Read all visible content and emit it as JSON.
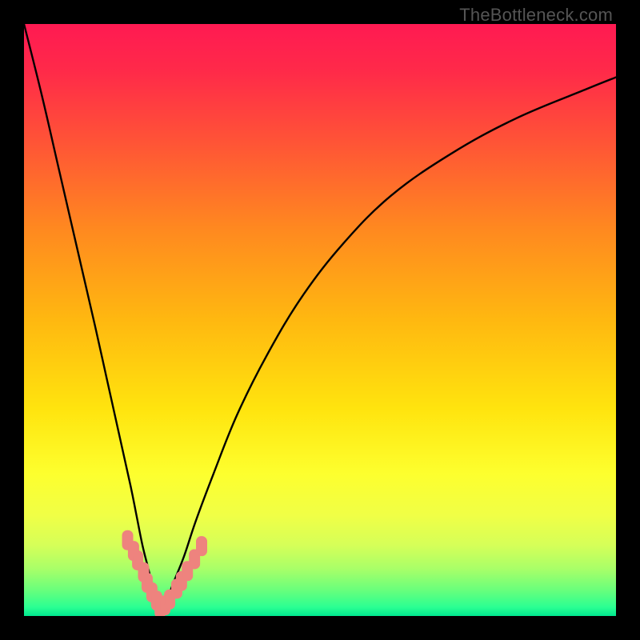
{
  "watermark": "TheBottleneck.com",
  "colors": {
    "frame": "#000000",
    "curve": "#000000",
    "markers_fill": "#ee837e",
    "markers_stroke": "#ee837e",
    "gradient_stops": [
      {
        "offset": 0.0,
        "color": "#ff1a52"
      },
      {
        "offset": 0.08,
        "color": "#ff2a49"
      },
      {
        "offset": 0.2,
        "color": "#ff5436"
      },
      {
        "offset": 0.35,
        "color": "#ff8a1f"
      },
      {
        "offset": 0.5,
        "color": "#ffb810"
      },
      {
        "offset": 0.65,
        "color": "#ffe40e"
      },
      {
        "offset": 0.76,
        "color": "#fdff2e"
      },
      {
        "offset": 0.83,
        "color": "#f0ff46"
      },
      {
        "offset": 0.88,
        "color": "#d6ff58"
      },
      {
        "offset": 0.92,
        "color": "#a9ff68"
      },
      {
        "offset": 0.955,
        "color": "#6bff7b"
      },
      {
        "offset": 0.985,
        "color": "#2bff92"
      },
      {
        "offset": 1.0,
        "color": "#00e88f"
      }
    ]
  },
  "chart_data": {
    "type": "line",
    "title": "",
    "xlabel": "",
    "ylabel": "",
    "xlim": [
      0,
      100
    ],
    "ylim": [
      0,
      100
    ],
    "note": "V-shaped bottleneck curve. x-axis spans approx 0–100 (normalized component ratio). y-axis spans 0–100 (bottleneck %, 0 = optimal/green at bottom, 100 = severe/red at top). Minimum near x≈23. Pink markers cluster near the bottom of the V (y < ~13).",
    "series": [
      {
        "name": "bottleneck-curve",
        "x": [
          0,
          3,
          6,
          9,
          12,
          14,
          16,
          18,
          19,
          20,
          21,
          22,
          23,
          24,
          25,
          27,
          29,
          32,
          36,
          41,
          47,
          54,
          62,
          72,
          83,
          95,
          100
        ],
        "y": [
          100,
          88,
          75,
          62,
          49,
          40,
          31,
          22,
          17,
          12,
          8,
          4,
          1.2,
          2,
          5,
          10,
          16,
          24,
          34,
          44,
          54,
          63,
          71,
          78,
          84,
          89,
          91
        ]
      },
      {
        "name": "marker-points",
        "x": [
          17.5,
          18.5,
          19.2,
          20.2,
          20.8,
          21.6,
          22.4,
          23.0,
          23.8,
          24.6,
          25.8,
          26.6,
          27.6,
          28.8,
          30.0
        ],
        "y": [
          12.8,
          11.0,
          9.4,
          7.4,
          5.6,
          4.0,
          2.6,
          1.3,
          1.8,
          2.8,
          4.6,
          5.9,
          7.6,
          9.6,
          11.8
        ]
      }
    ]
  }
}
